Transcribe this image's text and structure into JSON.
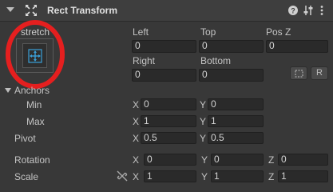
{
  "header": {
    "title": "Rect Transform"
  },
  "icons": {
    "component_icon": "move-arrows-icon",
    "help": "help-icon",
    "presets": "sliders-icon",
    "menu": "kebab-menu-icon",
    "expand": "expand-triangle-icon",
    "constrain": "constrain-link-icon"
  },
  "anchor_preset": {
    "label": "stretch",
    "highlight_color": "#e51f1f"
  },
  "position": {
    "labels": {
      "left": "Left",
      "top": "Top",
      "posz": "Pos Z",
      "right": "Right",
      "bottom": "Bottom"
    },
    "values": {
      "left": "0",
      "top": "0",
      "posz": "0",
      "right": "0",
      "bottom": "0"
    },
    "buttons": {
      "blueprint": "",
      "raw": "R"
    }
  },
  "anchors": {
    "label": "Anchors",
    "min": {
      "label": "Min",
      "x": "0",
      "y": "0"
    },
    "max": {
      "label": "Max",
      "x": "1",
      "y": "1"
    }
  },
  "pivot": {
    "label": "Pivot",
    "x": "0.5",
    "y": "0.5"
  },
  "rotation": {
    "label": "Rotation",
    "x": "0",
    "y": "0",
    "z": "0"
  },
  "scale": {
    "label": "Scale",
    "x": "1",
    "y": "1",
    "z": "1"
  },
  "axes": {
    "x": "X",
    "y": "Y",
    "z": "Z"
  }
}
